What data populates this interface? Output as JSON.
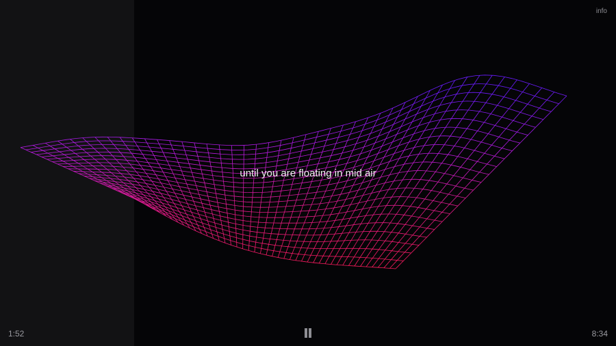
{
  "player": {
    "info_label": "info",
    "caption": "until you are floating in mid air",
    "elapsed": "1:52",
    "total": "8:34",
    "progress_fraction": 0.2179,
    "pause_icon": "pause-icon"
  },
  "colors": {
    "background": "#050507",
    "progress_fill": "#121214",
    "mesh_violet": "#6a1aff",
    "mesh_magenta": "#ff1a66"
  }
}
